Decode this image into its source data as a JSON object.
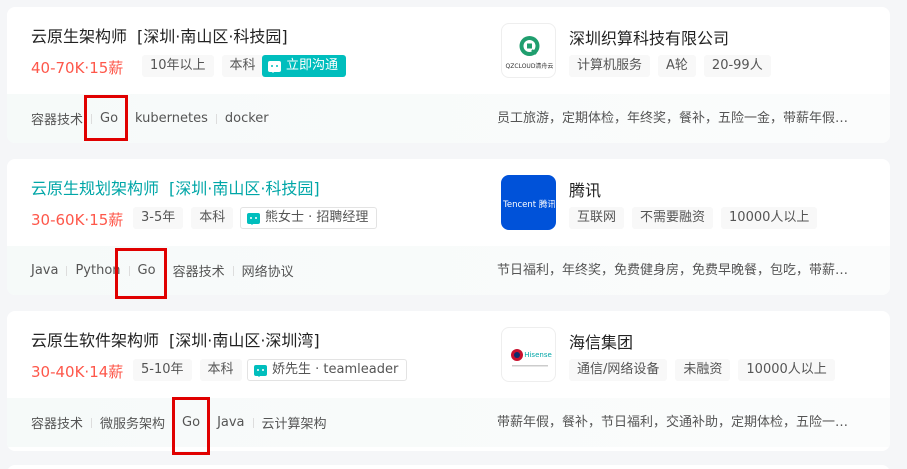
{
  "jobs": [
    {
      "title": "云原生架构师",
      "location": "[深圳·南山区·科技园]",
      "salary": "40-70K·15薪",
      "tags": [
        "10年以上",
        "本科"
      ],
      "chat": "立即沟通",
      "skills": [
        "容器技术",
        "Go",
        "kubernetes",
        "docker"
      ],
      "welfare": "员工旅游，定期体检，年终奖，餐补，五险一金，带薪年假…",
      "company": "深圳织算科技有限公司",
      "company_tags": [
        "计算机服务",
        "A轮",
        "20-99人"
      ],
      "logo_text": "QZCLOUD清舟云"
    },
    {
      "title": "云原生规划架构师",
      "location": "[深圳·南山区·科技园]",
      "salary": "30-60K·15薪",
      "tags": [
        "3-5年",
        "本科"
      ],
      "chat": "熊女士 · 招聘经理",
      "skills": [
        "Java",
        "Python",
        "Go",
        "容器技术",
        "网络协议"
      ],
      "welfare": "节日福利，年终奖，免费健身房，免费早晚餐，包吃，带薪…",
      "company": "腾讯",
      "company_tags": [
        "互联网",
        "不需要融资",
        "10000人以上"
      ],
      "logo_text": "Tencent 腾讯"
    },
    {
      "title": "云原生软件架构师",
      "location": "[深圳·南山区·深圳湾]",
      "salary": "30-40K·14薪",
      "tags": [
        "5-10年",
        "本科"
      ],
      "chat": "娇先生 · teamleader",
      "skills": [
        "容器技术",
        "微服务架构",
        "Go",
        "Java",
        "云计算架构"
      ],
      "welfare": "带薪年假，餐补，节日福利，交通补助，定期体检，五险一…",
      "company": "海信集团",
      "company_tags": [
        "通信/网络设备",
        "未融资",
        "10000人以上"
      ],
      "logo_text": "Hisense"
    }
  ],
  "colors": {
    "salary": "#fe574a",
    "accent": "#00bebd",
    "highlight": "#e00000",
    "tencent_blue": "#0052d9"
  }
}
